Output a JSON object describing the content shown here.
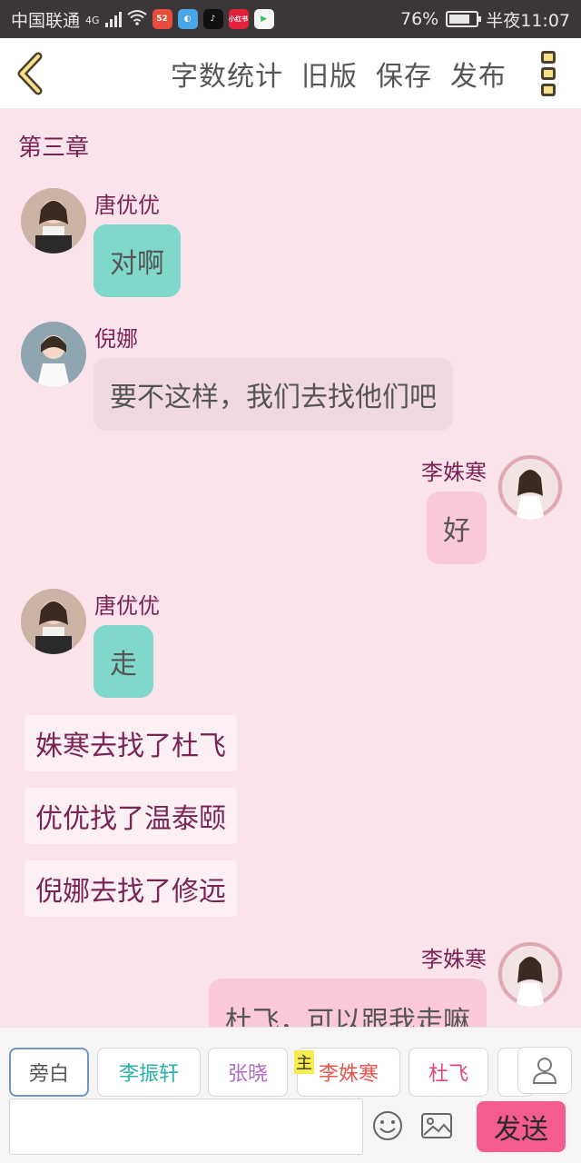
{
  "status_bar": {
    "carrier": "中国联通",
    "network": "4G",
    "battery": "76%",
    "battery_level": 0.76,
    "time": "半夜11:07",
    "app_icons": [
      "app-icon-1",
      "app-icon-2",
      "tiktok-icon",
      "app-icon-4",
      "app-icon-5"
    ]
  },
  "header": {
    "back_icon": "chevron-left-icon",
    "actions": [
      "字数统计",
      "旧版",
      "保存",
      "发布"
    ],
    "more_icon": "more-vertical-icon"
  },
  "chapter_title": "第三章",
  "messages": [
    {
      "type": "left",
      "speaker": "唐优优",
      "text": "对啊",
      "style": "teal"
    },
    {
      "type": "left",
      "speaker": "倪娜",
      "text": "要不这样，我们去找他们吧",
      "style": "grey"
    },
    {
      "type": "right",
      "speaker": "李姝寒",
      "text": "好",
      "style": "pink"
    },
    {
      "type": "left",
      "speaker": "唐优优",
      "text": "走",
      "style": "teal"
    },
    {
      "type": "narration",
      "text": "姝寒去找了杜飞"
    },
    {
      "type": "narration",
      "text": "优优找了温泰颐"
    },
    {
      "type": "narration",
      "text": "倪娜去找了修远"
    },
    {
      "type": "right",
      "speaker": "李姝寒",
      "text": "杜飞，可以跟我走嘛",
      "style": "pink"
    }
  ],
  "role_chips": [
    {
      "label": "旁白",
      "color": "#555555",
      "active": true
    },
    {
      "label": "李振轩",
      "color": "#27b3a6",
      "active": false
    },
    {
      "label": "张晓",
      "color": "#b06ac7",
      "active": false
    },
    {
      "label": "李姝寒",
      "color": "#e8554e",
      "active": false
    },
    {
      "label": "杜飞",
      "color": "#e0457e",
      "active": false
    }
  ],
  "main_tag": "主",
  "input": {
    "placeholder": "",
    "value": ""
  },
  "send_label": "发送",
  "colors": {
    "accent": "#f35c8d",
    "name": "#7a2455",
    "teal": "#7fd8c9",
    "pink": "#fbc9d8"
  }
}
